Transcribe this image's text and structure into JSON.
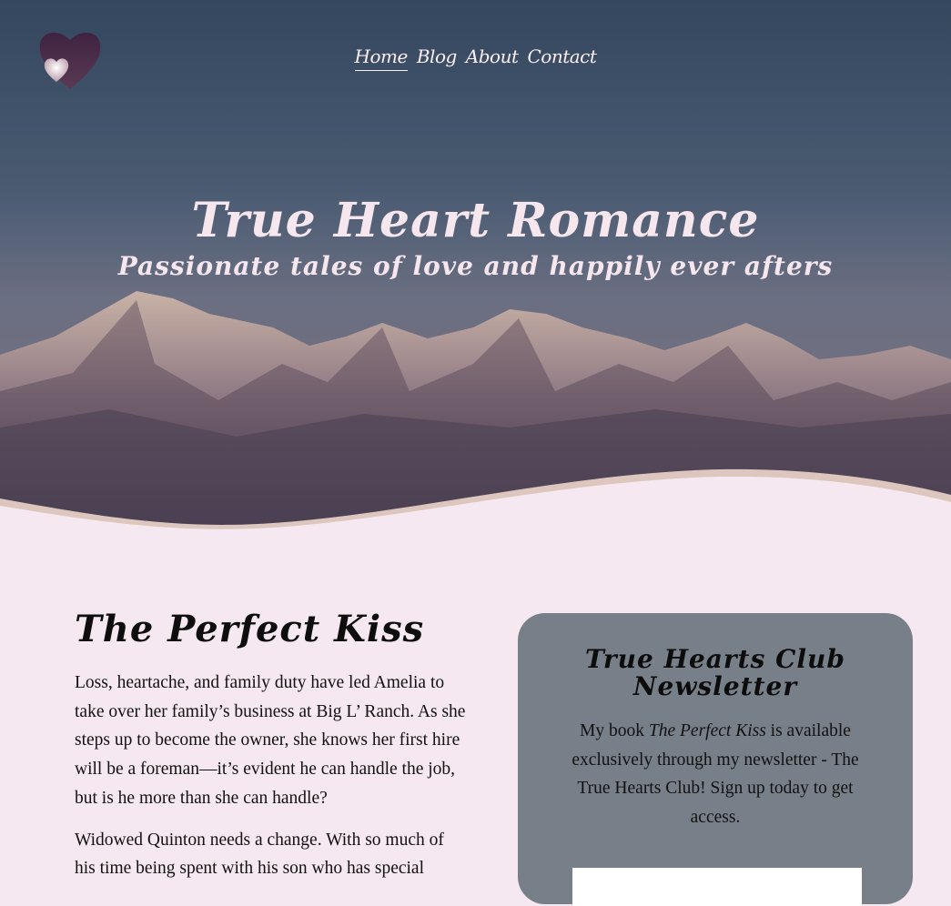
{
  "nav": {
    "items": [
      {
        "label": "Home",
        "active": true
      },
      {
        "label": "Blog",
        "active": false
      },
      {
        "label": "About",
        "active": false
      },
      {
        "label": "Contact",
        "active": false
      }
    ]
  },
  "hero": {
    "title": "True Heart Romance",
    "subtitle": "Passionate tales of love and happily ever afters"
  },
  "book": {
    "title": "The Perfect Kiss",
    "paragraph1": "Loss, heartache, and family duty have led Amelia to take over her family’s business at Big L’ Ranch. As she steps up to become the owner, she knows her first hire will be a foreman—it’s evident he can handle the job, but is he more than she can handle?",
    "paragraph2": "Widowed Quinton needs a change. With so much of his time being spent with his son who has special"
  },
  "newsletter": {
    "title": "True Hearts Club Newsletter",
    "text_before": "My book ",
    "book_name": "The Perfect Kiss",
    "text_after": " is available exclusively through my newsletter - The True Hearts Club! Sign up today to get access.",
    "email_placeholder": ""
  },
  "colors": {
    "background": "#f5e8f0",
    "card": "#778089",
    "hero_text": "#f6e6ee",
    "wave_accent": "#dcc6bd"
  }
}
